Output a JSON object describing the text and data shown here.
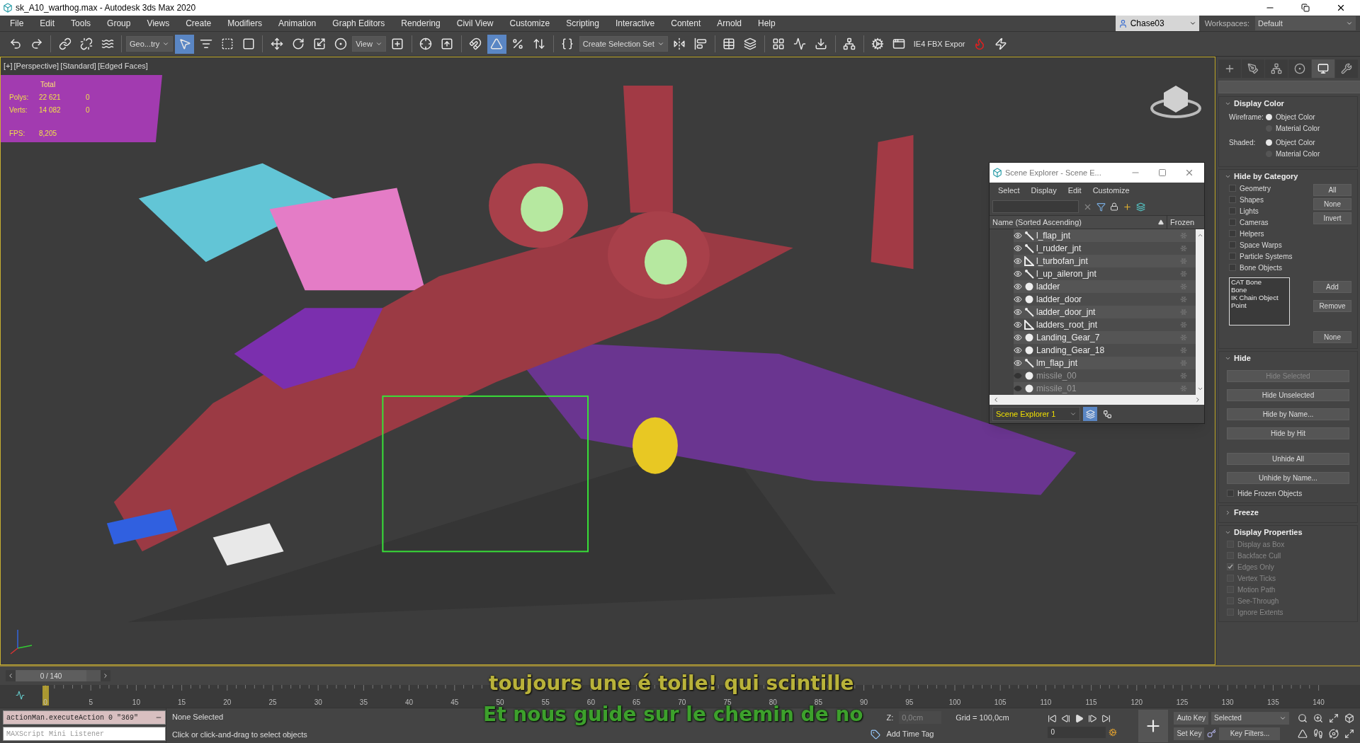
{
  "window": {
    "title": "sk_A10_warthog.max - Autodesk 3ds Max 2020"
  },
  "menu": [
    "File",
    "Edit",
    "Tools",
    "Group",
    "Views",
    "Create",
    "Modifiers",
    "Animation",
    "Graph Editors",
    "Rendering",
    "Civil View",
    "Customize",
    "Scripting",
    "Interactive",
    "Content",
    "Arnold",
    "Help"
  ],
  "user": {
    "name": "Chase03"
  },
  "workspaces": {
    "label": "Workspaces:",
    "value": "Default"
  },
  "toolbar": {
    "groups": [
      [
        {
          "kind": "undo",
          "selected": false
        },
        {
          "kind": "redo",
          "selected": false
        }
      ],
      [
        {
          "kind": "link",
          "selected": false
        },
        {
          "kind": "unlink",
          "selected": false
        },
        {
          "kind": "bind",
          "selected": false
        }
      ],
      [
        {
          "kind": "dropdown",
          "text": "Geo...try",
          "selected": false
        },
        {
          "kind": "select",
          "selected": true
        },
        {
          "kind": "select_by_name",
          "selected": false
        },
        {
          "kind": "region",
          "selected": false
        },
        {
          "kind": "crossing",
          "selected": false
        }
      ],
      [
        {
          "kind": "move",
          "selected": false
        },
        {
          "kind": "rotate",
          "selected": false
        },
        {
          "kind": "scale",
          "selected": false
        },
        {
          "kind": "placement",
          "selected": false
        },
        {
          "kind": "dropdown",
          "text": "View",
          "selected": false
        },
        {
          "kind": "pivot",
          "selected": false
        }
      ],
      [
        {
          "kind": "manipulate",
          "selected": false
        },
        {
          "kind": "keyboard",
          "selected": false
        }
      ],
      [
        {
          "kind": "snap",
          "selected": false
        },
        {
          "kind": "angle",
          "selected": true
        },
        {
          "kind": "percent",
          "selected": false
        },
        {
          "kind": "spinner",
          "selected": false
        }
      ],
      [
        {
          "kind": "named",
          "selected": false
        },
        {
          "kind": "dropdown",
          "text": "Create Selection Set",
          "selected": false
        },
        {
          "kind": "mirror",
          "selected": false
        },
        {
          "kind": "align",
          "selected": false
        }
      ],
      [
        {
          "kind": "explorer",
          "selected": false
        },
        {
          "kind": "layers",
          "selected": false
        }
      ],
      [
        {
          "kind": "ribbon",
          "selected": false
        },
        {
          "kind": "curve",
          "selected": false
        },
        {
          "kind": "dope",
          "selected": false
        }
      ],
      [
        {
          "kind": "schematic",
          "selected": false
        }
      ],
      [
        {
          "kind": "render_setup",
          "selected": false
        },
        {
          "kind": "frame_window",
          "selected": false
        },
        {
          "kind": "label",
          "text": "IE4 FBX Expor",
          "selected": false
        },
        {
          "kind": "logo",
          "selected": false
        },
        {
          "kind": "render",
          "selected": false
        }
      ]
    ]
  },
  "viewport": {
    "labels": [
      "[+]",
      "[Perspective]",
      "[Standard]",
      "[Edged Faces]"
    ],
    "stats": {
      "header": "Total",
      "rows": [
        {
          "label": "Polys:",
          "value": "22 621",
          "value_2": "0"
        },
        {
          "label": "Verts:",
          "value": "14 082",
          "value_2": "0"
        }
      ],
      "fps_label": "FPS:",
      "fps": "8,205"
    }
  },
  "subtitles": [
    "toujours une é toile! qui scintille",
    "Et nous guide sur le chemin de no"
  ],
  "scene_explorer": {
    "title": "Scene Explorer - Scene E...",
    "menu": [
      "Select",
      "Display",
      "Edit",
      "Customize"
    ],
    "columns": [
      "Name (Sorted Ascending)",
      "Frozen"
    ],
    "rows": [
      {
        "name": "l_flap_jnt",
        "kind": "bone",
        "visible": true
      },
      {
        "name": "l_rudder_jnt",
        "kind": "bone",
        "visible": true
      },
      {
        "name": "l_turbofan_jnt",
        "kind": "root",
        "visible": true
      },
      {
        "name": "l_up_aileron_jnt",
        "kind": "bone",
        "visible": true
      },
      {
        "name": "ladder",
        "kind": "mesh",
        "visible": true
      },
      {
        "name": "ladder_door",
        "kind": "mesh",
        "visible": true
      },
      {
        "name": "ladder_door_jnt",
        "kind": "bone",
        "visible": true
      },
      {
        "name": "ladders_root_jnt",
        "kind": "root",
        "visible": true
      },
      {
        "name": "Landing_Gear_7",
        "kind": "mesh",
        "visible": true
      },
      {
        "name": "Landing_Gear_18",
        "kind": "mesh",
        "visible": true
      },
      {
        "name": "lm_flap_jnt",
        "kind": "bone",
        "visible": true
      },
      {
        "name": "missile_00",
        "kind": "mesh",
        "visible": false
      },
      {
        "name": "missile_01",
        "kind": "mesh",
        "visible": false
      }
    ],
    "explorer_name": "Scene Explorer 1",
    "view_buttons": [
      {
        "kind": "layers",
        "selected": true
      },
      {
        "kind": "hierarchy",
        "selected": false
      }
    ]
  },
  "command_panel": {
    "tabs": [
      {
        "kind": "create",
        "selected": false
      },
      {
        "kind": "modify",
        "selected": false
      },
      {
        "kind": "hierarchy",
        "selected": false
      },
      {
        "kind": "motion",
        "selected": false
      },
      {
        "kind": "display",
        "selected": true
      },
      {
        "kind": "utilities",
        "selected": false
      }
    ],
    "display_color": {
      "title": "Display Color",
      "expanded": true,
      "groups": [
        {
          "label": "Wireframe:",
          "options": [
            {
              "label": "Object Color",
              "selected": true
            },
            {
              "label": "Material Color",
              "selected": false
            }
          ]
        },
        {
          "label": "Shaded:",
          "options": [
            {
              "label": "Object Color",
              "selected": true
            },
            {
              "label": "Material Color",
              "selected": false
            }
          ]
        }
      ]
    },
    "hide_by_category": {
      "title": "Hide by Category",
      "expanded": true,
      "categories": [
        {
          "label": "Geometry",
          "checked": false
        },
        {
          "label": "Shapes",
          "checked": false
        },
        {
          "label": "Lights",
          "checked": false
        },
        {
          "label": "Cameras",
          "checked": false
        },
        {
          "label": "Helpers",
          "checked": false
        },
        {
          "label": "Space Warps",
          "checked": false
        },
        {
          "label": "Particle Systems",
          "checked": false
        },
        {
          "label": "Bone Objects",
          "checked": false
        }
      ],
      "buttons": [
        "All",
        "None",
        "Invert"
      ],
      "list": [
        "CAT Bone",
        "Bone",
        "IK Chain Object",
        "Point"
      ],
      "list_buttons": [
        "Add",
        "Remove",
        "None"
      ]
    },
    "hide": {
      "title": "Hide",
      "expanded": true,
      "buttons": [
        {
          "label": "Hide Selected",
          "disabled": true
        },
        {
          "label": "Hide Unselected",
          "disabled": false
        },
        {
          "label": "Hide by Name...",
          "disabled": false
        },
        {
          "label": "Hide by Hit",
          "disabled": false
        },
        {
          "label": "Unhide All",
          "disabled": false
        },
        {
          "label": "Unhide by Name...",
          "disabled": false
        }
      ],
      "checkbox": {
        "label": "Hide Frozen Objects",
        "checked": false
      }
    },
    "freeze": {
      "title": "Freeze",
      "expanded": false
    },
    "display_properties": {
      "title": "Display Properties",
      "expanded": true,
      "items": [
        {
          "label": "Display as Box",
          "checked": false,
          "disabled": true
        },
        {
          "label": "Backface Cull",
          "checked": false,
          "disabled": true
        },
        {
          "label": "Edges Only",
          "checked": true,
          "disabled": true
        },
        {
          "label": "Vertex Ticks",
          "checked": false,
          "disabled": true
        },
        {
          "label": "Motion Path",
          "checked": false,
          "disabled": true
        },
        {
          "label": "See-Through",
          "checked": false,
          "disabled": true
        },
        {
          "label": "Ignore Extents",
          "checked": false,
          "disabled": true
        }
      ]
    }
  },
  "timeline": {
    "position": "0 / 140",
    "frames": [
      "0",
      "5",
      "10",
      "15",
      "20",
      "25",
      "30",
      "35",
      "40",
      "45",
      "50",
      "55",
      "60",
      "65",
      "70",
      "75",
      "80",
      "85",
      "90",
      "95",
      "100",
      "105",
      "110",
      "115",
      "120",
      "125",
      "130",
      "135",
      "140"
    ]
  },
  "status": {
    "listener_command": "actionMan.executeAction 0 \"369\"",
    "listener_placeholder": "MAXScript Mini Listener",
    "prompt": "None Selected",
    "hint": "Click or click-and-drag to select objects",
    "z_label": "Z:",
    "z_value": "0,0cm",
    "grid": "Grid = 100,0cm",
    "add_time_tag": "Add Time Tag",
    "frame": "0",
    "auto_key": "Auto Key",
    "key_mode": "Selected",
    "set_key": "Set Key",
    "key_filters": "Key Filters..."
  }
}
